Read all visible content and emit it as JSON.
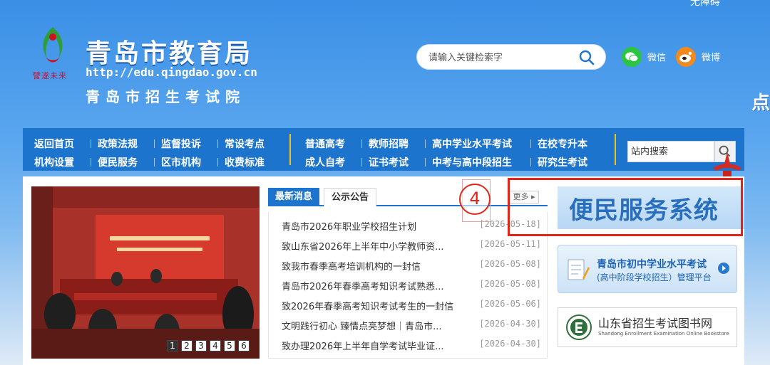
{
  "top_right_text": "无障碍",
  "header": {
    "motto": "譬遂未来",
    "title": "青岛市教育局",
    "url": "http://edu.qingdao.gov.cn",
    "subtitle": "青岛市招生考试院"
  },
  "search": {
    "placeholder": "请输入关键检索字"
  },
  "social": {
    "wechat_label": "微信",
    "weibo_label": "微博"
  },
  "nav": {
    "row1": [
      "返回首页",
      "政策法规",
      "监督投诉",
      "常设考点",
      "普通高考",
      "教师招聘",
      "高中学业水平考试",
      "在校专升本"
    ],
    "row2": [
      "机构设置",
      "便民服务",
      "区市机构",
      "收费标准",
      "成人自考",
      "证书考试",
      "中考与高中段招生",
      "研究生考试"
    ],
    "site_search_placeholder": "站内搜索"
  },
  "decoration": {
    "mascot_text": "点"
  },
  "photo": {
    "pages": [
      "1",
      "2",
      "3",
      "4",
      "5",
      "6"
    ],
    "active_page": "1"
  },
  "news": {
    "tabs": [
      "最新消息",
      "公示公告"
    ],
    "more_label": "更多 ▸",
    "items": [
      {
        "title": "青岛市2026年职业学校招生计划",
        "date": "[2026-05-18]"
      },
      {
        "title": "致山东省2026年上半年中小学教师资...",
        "date": "[2026-05-11]"
      },
      {
        "title": "致我市春季高考培训机构的一封信",
        "date": "[2026-05-08]"
      },
      {
        "title": "青岛市2026年春季高考知识考试熟悉...",
        "date": "[2026-05-08]"
      },
      {
        "title": "致2026年春季高考知识考试考生的一封信",
        "date": "[2026-05-06]"
      },
      {
        "title": "文明践行初心 臻情点亮梦想｜青岛市...",
        "date": "[2026-04-30]"
      },
      {
        "title": "致办理2026年上半年自学考试毕业证...",
        "date": "[2026-04-30]"
      }
    ]
  },
  "annotation": {
    "number": "4"
  },
  "banners": {
    "service_system": "便民服务系统",
    "junior_exam_title": "青岛市初中学业水平考试",
    "junior_exam_sub": "(高中阶段学校招生）管理平台",
    "bookstore_title": "山东省招生考试图书网",
    "bookstore_sub": "Shandong Enrollment Examination Online Bookstore"
  },
  "colors": {
    "nav_blue": "#1c74cc",
    "accent_gold": "#f0c419",
    "annotation_red": "#e0241a"
  }
}
